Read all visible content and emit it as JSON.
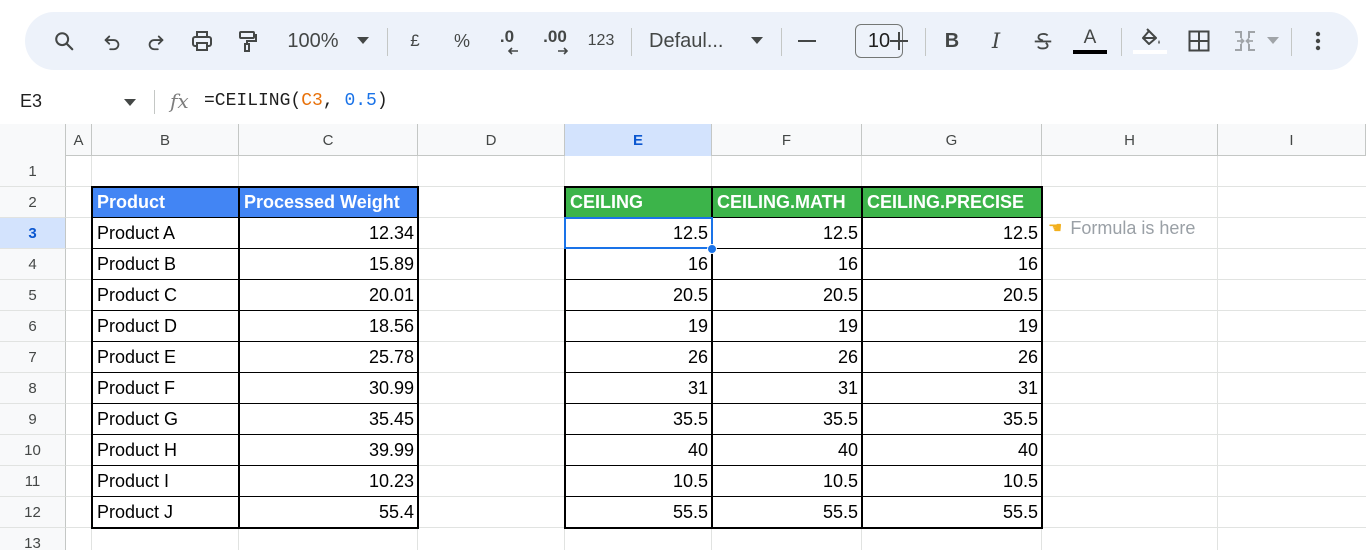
{
  "toolbar": {
    "zoom": "100%",
    "currency": "£",
    "percent": "%",
    "decrease_decimal": ".0",
    "increase_decimal": ".00",
    "number_format": "123",
    "font": "Defaul...",
    "font_size": "10",
    "bold": "B",
    "italic": "I",
    "text_color_letter": "A"
  },
  "formula_bar": {
    "name_box": "E3",
    "fx": "fx",
    "formula_prefix": "=CEILING(",
    "formula_ref": "C3",
    "formula_sep": ", ",
    "formula_num": "0.5",
    "formula_suffix": ")"
  },
  "columns": [
    "A",
    "B",
    "C",
    "D",
    "E",
    "F",
    "G",
    "H",
    "I"
  ],
  "rows": [
    "1",
    "2",
    "3",
    "4",
    "5",
    "6",
    "7",
    "8",
    "9",
    "10",
    "11",
    "12",
    "13"
  ],
  "left_table": {
    "headers": [
      "Product",
      "Processed Weight"
    ],
    "rows": [
      [
        "Product A",
        "12.34"
      ],
      [
        "Product B",
        "15.89"
      ],
      [
        "Product C",
        "20.01"
      ],
      [
        "Product D",
        "18.56"
      ],
      [
        "Product E",
        "25.78"
      ],
      [
        "Product F",
        "30.99"
      ],
      [
        "Product G",
        "35.45"
      ],
      [
        "Product H",
        "39.99"
      ],
      [
        "Product I",
        "10.23"
      ],
      [
        "Product J",
        "55.4"
      ]
    ]
  },
  "right_table": {
    "headers": [
      "CEILING",
      "CEILING.MATH",
      "CEILING.PRECISE"
    ],
    "rows": [
      [
        "12.5",
        "12.5",
        "12.5"
      ],
      [
        "16",
        "16",
        "16"
      ],
      [
        "20.5",
        "20.5",
        "20.5"
      ],
      [
        "19",
        "19",
        "19"
      ],
      [
        "26",
        "26",
        "26"
      ],
      [
        "31",
        "31",
        "31"
      ],
      [
        "35.5",
        "35.5",
        "35.5"
      ],
      [
        "40",
        "40",
        "40"
      ],
      [
        "10.5",
        "10.5",
        "10.5"
      ],
      [
        "55.5",
        "55.5",
        "55.5"
      ]
    ]
  },
  "note": {
    "icon": "pointing-hand-icon",
    "text": "Formula is here"
  },
  "colors": {
    "product_header": "#4285f4",
    "ceiling_header": "#3cb44a",
    "selection": "#1a73e8"
  }
}
